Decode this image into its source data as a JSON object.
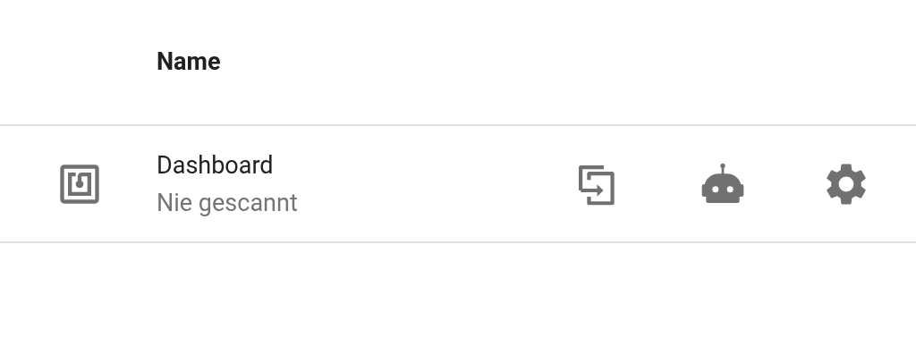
{
  "table": {
    "columns": [
      {
        "label": "Name"
      }
    ],
    "rows": [
      {
        "name": "Dashboard",
        "status": "Nie gescannt"
      }
    ]
  }
}
